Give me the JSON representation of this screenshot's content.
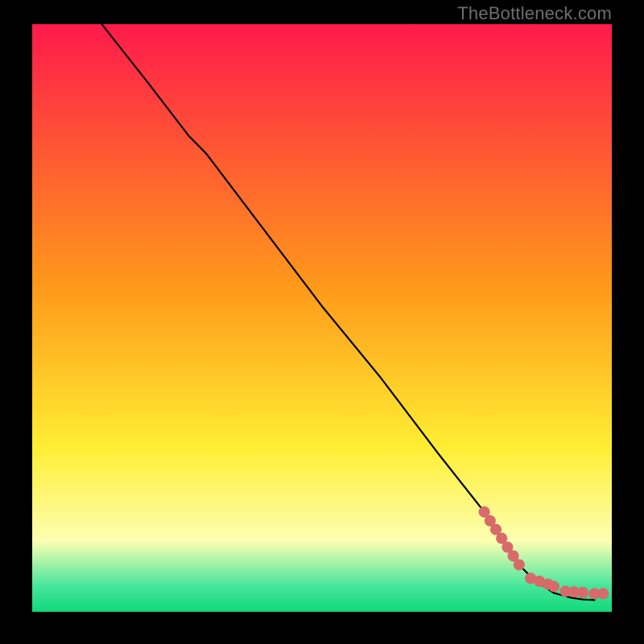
{
  "watermark": "TheBottleneck.com",
  "colors": {
    "top": "#ff1a4b",
    "orange": "#ff9a1a",
    "yellow": "#ffee33",
    "pale_yellow": "#fdffb2",
    "teal": "#49e69d",
    "green": "#10d979",
    "line": "#000000",
    "marker": "#d86a6a",
    "bg": "#000000"
  },
  "chart_data": {
    "type": "line",
    "title": "",
    "xlabel": "",
    "ylabel": "",
    "xlim": [
      0,
      100
    ],
    "ylim": [
      0,
      100
    ],
    "comment": "x/y are percent of plot width/height measured from bottom-left",
    "series": [
      {
        "name": "curve",
        "x": [
          12,
          20,
          27,
          30,
          40,
          50,
          60,
          70,
          78,
          80,
          82,
          84,
          86,
          88,
          90,
          93,
          95,
          97
        ],
        "y": [
          100,
          90,
          81,
          78,
          65,
          52,
          40,
          27,
          17,
          14,
          11,
          8,
          6,
          4.5,
          3.2,
          2.4,
          2.1,
          2.0
        ]
      }
    ],
    "markers": {
      "name": "points",
      "x": [
        78,
        79,
        80,
        81,
        82,
        83,
        84,
        86,
        87.5,
        89,
        90,
        92,
        93.5,
        95,
        97,
        98.5
      ],
      "y": [
        17,
        15.5,
        14,
        12.5,
        11,
        9.5,
        8,
        5.7,
        5.2,
        4.7,
        4.3,
        3.5,
        3.4,
        3.3,
        3.1,
        3.1
      ]
    },
    "gradient_stops": [
      {
        "offset": 0.0,
        "color_key": "top"
      },
      {
        "offset": 0.45,
        "color_key": "orange"
      },
      {
        "offset": 0.72,
        "color_key": "yellow"
      },
      {
        "offset": 0.88,
        "color_key": "pale_yellow"
      },
      {
        "offset": 0.955,
        "color_key": "teal"
      },
      {
        "offset": 1.0,
        "color_key": "green"
      }
    ]
  }
}
